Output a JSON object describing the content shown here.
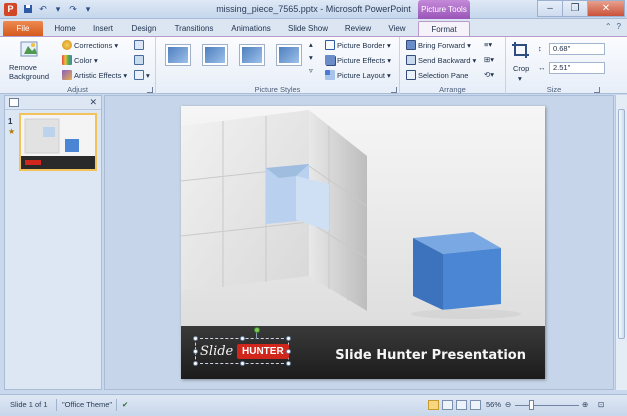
{
  "window": {
    "title": "missing_piece_7565.pptx - Microsoft PowerPoint",
    "contextual_tab_group": "Picture Tools"
  },
  "tabs": [
    {
      "label": "File"
    },
    {
      "label": "Home"
    },
    {
      "label": "Insert"
    },
    {
      "label": "Design"
    },
    {
      "label": "Transitions"
    },
    {
      "label": "Animations"
    },
    {
      "label": "Slide Show"
    },
    {
      "label": "Review"
    },
    {
      "label": "View"
    },
    {
      "label": "Format"
    }
  ],
  "ribbon": {
    "adjust": {
      "label": "Adjust",
      "remove_background_1": "Remove",
      "remove_background_2": "Background",
      "corrections": "Corrections",
      "color": "Color",
      "artistic_effects": "Artistic Effects"
    },
    "picture_styles": {
      "label": "Picture Styles",
      "picture_border": "Picture Border",
      "picture_effects": "Picture Effects",
      "picture_layout": "Picture Layout"
    },
    "arrange": {
      "label": "Arrange",
      "bring_forward": "Bring Forward",
      "send_backward": "Send Backward",
      "selection_pane": "Selection Pane"
    },
    "size": {
      "label": "Size",
      "crop": "Crop",
      "height": "0.68\"",
      "width": "2.51\""
    }
  },
  "thumbnails": {
    "slide_number": "1",
    "thumb_logo": "Slide HUNTER",
    "thumb_caption": "Slide Hunter Presentation"
  },
  "slide": {
    "logo_word1": "Slide",
    "logo_word2": "HUNTER",
    "title": "Slide Hunter Presentation"
  },
  "status": {
    "slide_info": "Slide 1 of 1",
    "theme": "\"Office Theme\"",
    "zoom": "56%"
  },
  "colors": {
    "accent_file_tab": "#d35a1f",
    "contextual_purple": "#9a55b8",
    "hunter_red": "#d0261c",
    "cube_blue": "#4a86d4"
  }
}
